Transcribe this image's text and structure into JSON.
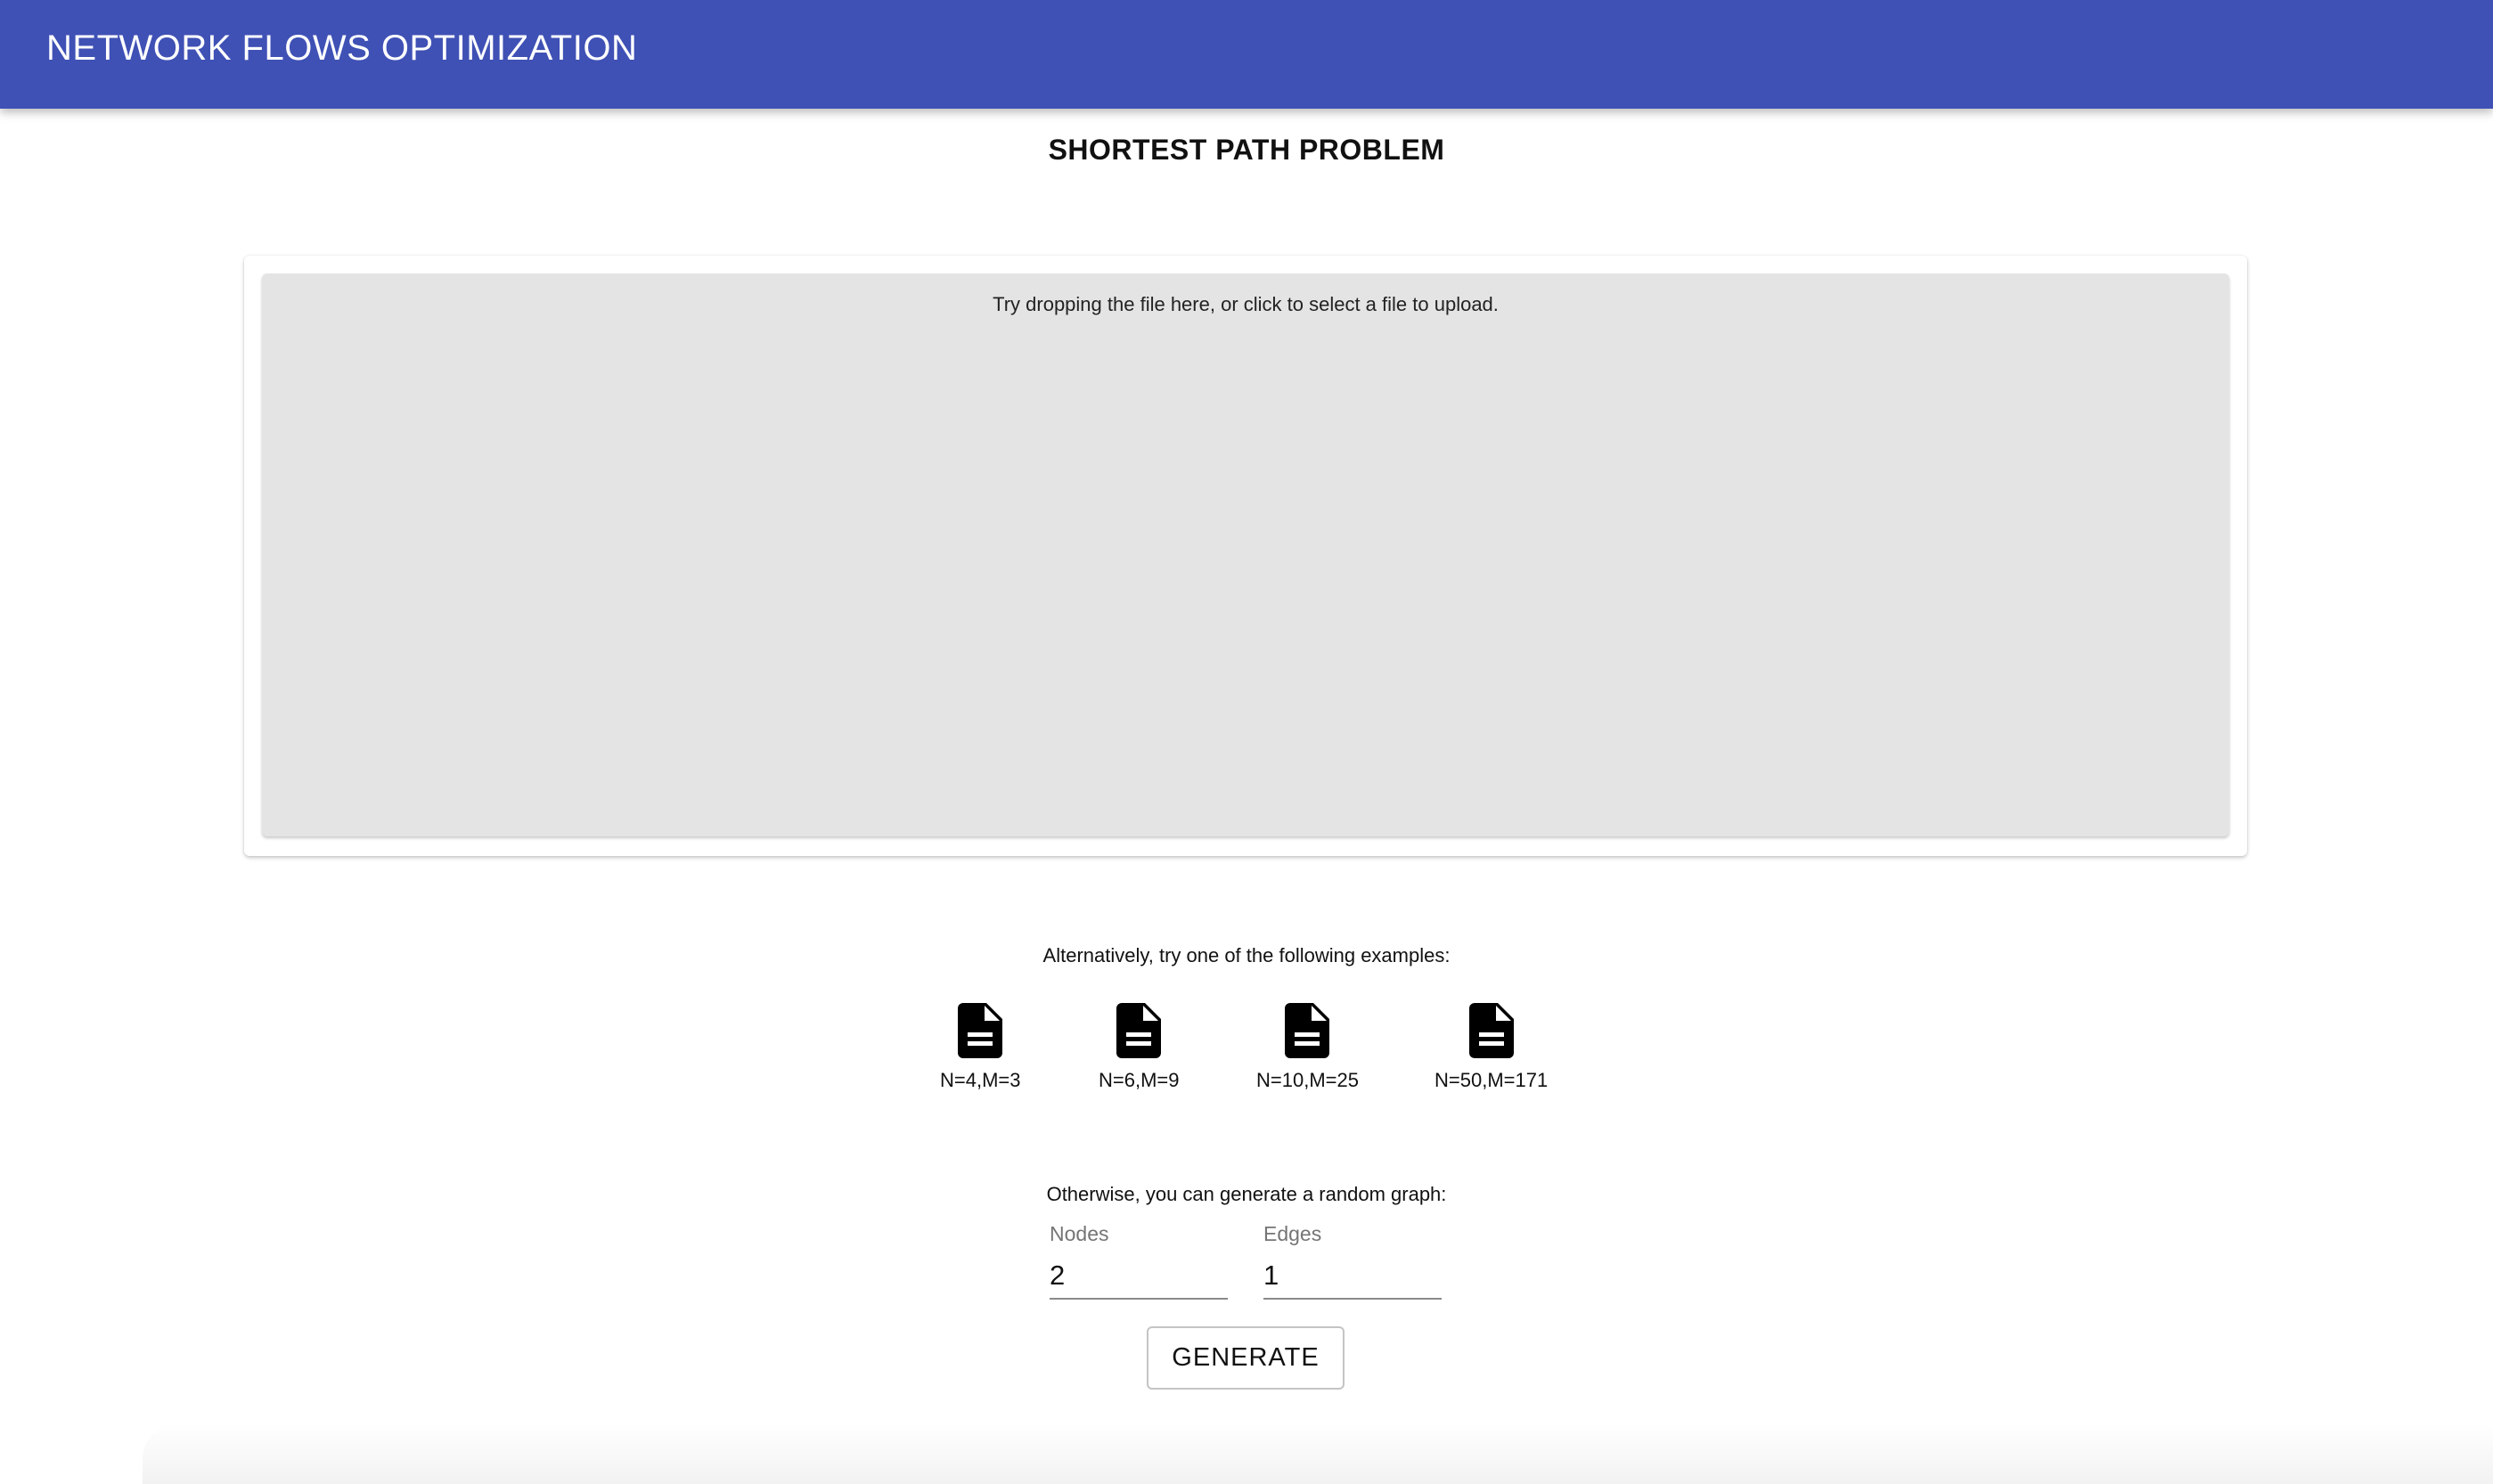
{
  "app_bar": {
    "title": "NETWORK FLOWS OPTIMIZATION",
    "color": "#3f51b5"
  },
  "page": {
    "title": "SHORTEST PATH PROBLEM"
  },
  "upload": {
    "hint": "Try dropping the file here, or click to select a file to upload."
  },
  "examples": {
    "label": "Alternatively, try one of the following examples:",
    "icon": "file-document-icon",
    "items": [
      {
        "label": "N=4,M=3"
      },
      {
        "label": "N=6,M=9"
      },
      {
        "label": "N=10,M=25"
      },
      {
        "label": "N=50,M=171"
      }
    ]
  },
  "generator": {
    "label": "Otherwise, you can generate a random graph:",
    "nodes": {
      "label": "Nodes",
      "value": "2"
    },
    "edges": {
      "label": "Edges",
      "value": "1"
    },
    "button_label": "GENERATE"
  }
}
